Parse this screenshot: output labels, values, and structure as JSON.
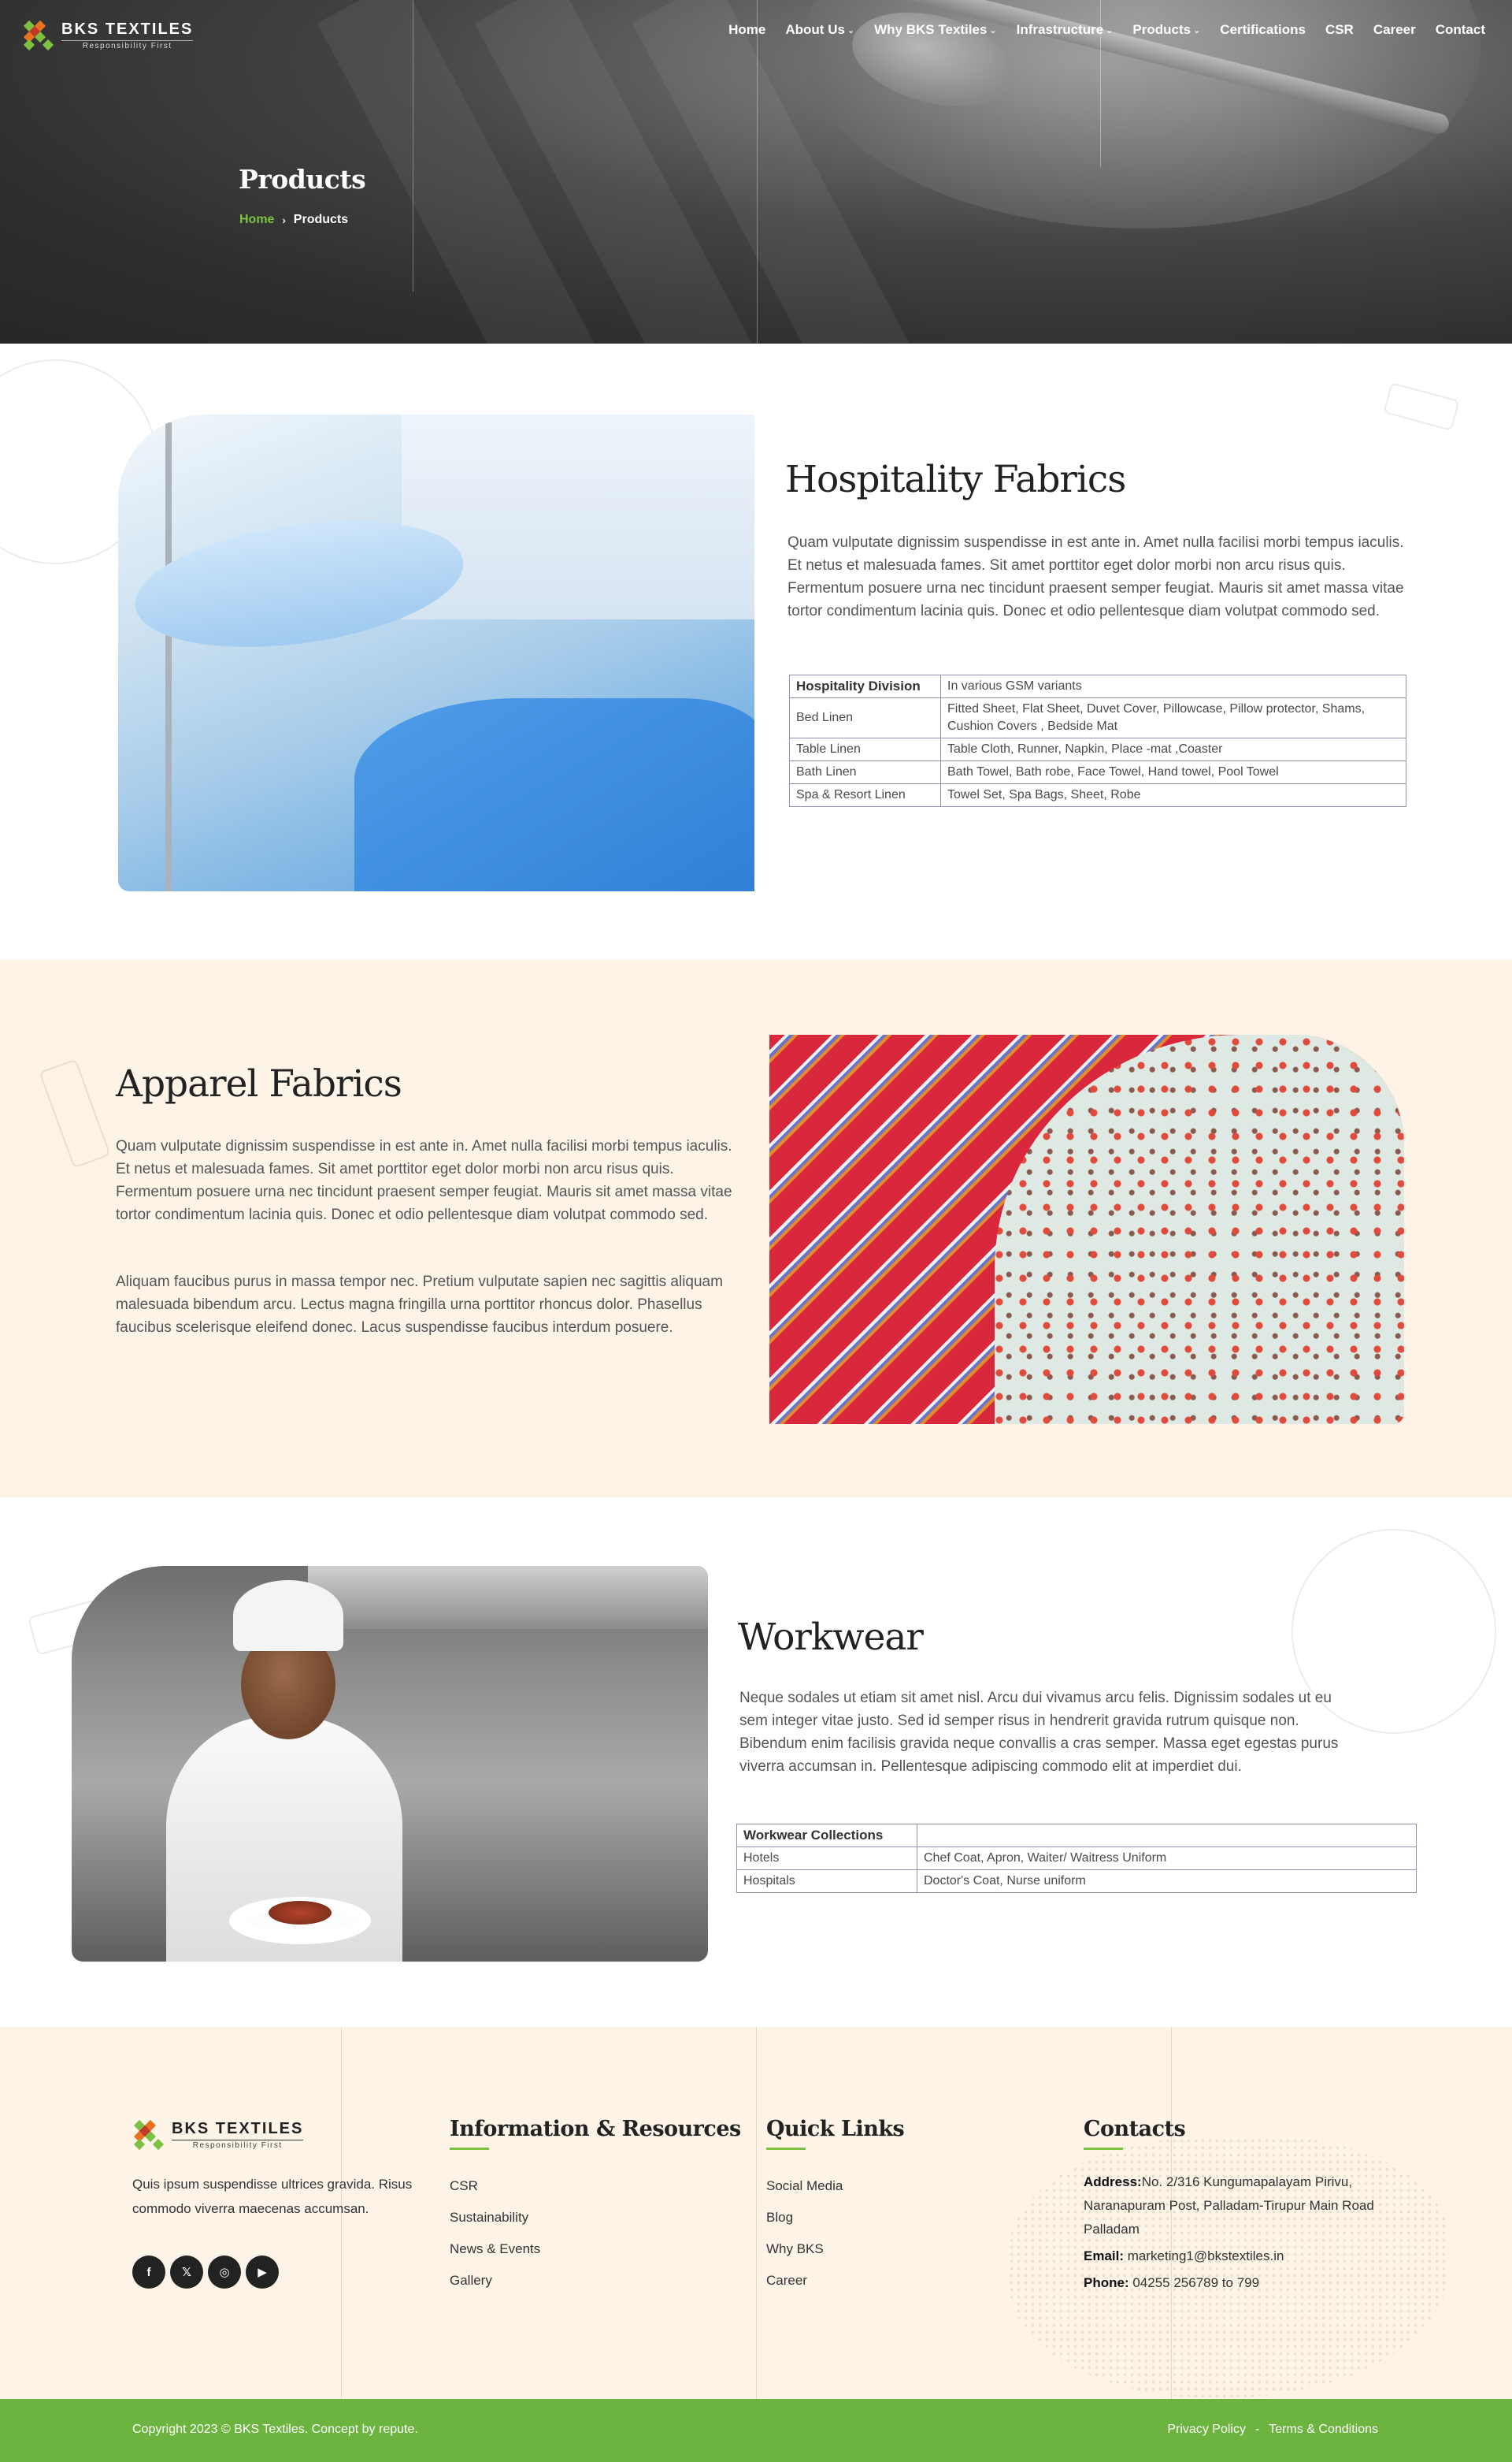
{
  "header": {
    "logo_name": "BKS TEXTILES",
    "logo_tagline": "Responsibility First",
    "nav": [
      {
        "label": "Home",
        "dropdown": false
      },
      {
        "label": "About Us",
        "dropdown": true
      },
      {
        "label": "Why BKS Textiles",
        "dropdown": true
      },
      {
        "label": "Infrastructure",
        "dropdown": true
      },
      {
        "label": "Products",
        "dropdown": true
      },
      {
        "label": "Certifications",
        "dropdown": false
      },
      {
        "label": "CSR",
        "dropdown": false
      },
      {
        "label": "Career",
        "dropdown": false
      },
      {
        "label": "Contact",
        "dropdown": false
      }
    ],
    "chevron": "⌄"
  },
  "hero": {
    "title": "Products",
    "breadcrumb_home": "Home",
    "breadcrumb_separator": "›",
    "breadcrumb_current": "Products"
  },
  "hospitality": {
    "title": "Hospitality Fabrics",
    "text": "Quam vulputate dignissim suspendisse in est ante in. Amet nulla facilisi morbi tempus iaculis. Et netus et malesuada fames. Sit amet porttitor eget dolor morbi non arcu risus quis. Fermentum posuere urna nec tincidunt praesent semper feugiat. Mauris sit amet massa vitae tortor condimentum lacinia quis. Donec et odio pellentesque diam volutpat commodo sed.",
    "table_header": [
      "Hospitality Division",
      "In various GSM variants"
    ],
    "table_rows": [
      [
        "Bed Linen",
        "Fitted Sheet, Flat Sheet, Duvet Cover, Pillowcase, Pillow protector, Shams, Cushion Covers , Bedside Mat"
      ],
      [
        "Table Linen",
        "Table Cloth, Runner, Napkin,  Place -mat ,Coaster"
      ],
      [
        "Bath Linen",
        "Bath Towel, Bath robe, Face Towel, Hand towel, Pool Towel"
      ],
      [
        "Spa & Resort Linen",
        "Towel Set, Spa Bags, Sheet, Robe"
      ]
    ]
  },
  "apparel": {
    "title": "Apparel Fabrics",
    "text_1": "Quam vulputate dignissim suspendisse in est ante in. Amet nulla facilisi morbi tempus iaculis. Et netus et malesuada fames. Sit amet porttitor eget dolor morbi non arcu risus quis. Fermentum posuere urna nec tincidunt praesent semper feugiat. Mauris sit amet massa vitae tortor condimentum lacinia quis. Donec et odio pellentesque diam volutpat commodo sed.",
    "text_2": "Aliquam faucibus purus in massa tempor nec. Pretium vulputate sapien nec sagittis aliquam malesuada bibendum arcu. Lectus magna fringilla urna porttitor rhoncus dolor. Phasellus faucibus scelerisque eleifend donec. Lacus suspendisse faucibus interdum posuere."
  },
  "workwear": {
    "title": "Workwear",
    "text": "Neque sodales ut etiam sit amet nisl. Arcu dui vivamus arcu felis. Dignissim sodales ut eu sem integer vitae justo. Sed id semper risus in hendrerit gravida rutrum quisque non. Bibendum enim facilisis gravida neque convallis a cras semper. Massa eget egestas purus viverra accumsan in. Pellentesque adipiscing commodo elit at imperdiet dui.",
    "table_header": [
      "Workwear Collections",
      ""
    ],
    "table_rows": [
      [
        "Hotels",
        "Chef Coat, Apron, Waiter/ Waitress Uniform"
      ],
      [
        "Hospitals",
        "Doctor's Coat, Nurse uniform"
      ]
    ]
  },
  "footer": {
    "logo_name": "BKS TEXTILES",
    "logo_tagline": "Responsibility First",
    "description": "Quis ipsum suspendisse ultrices gravida. Risus commodo viverra maecenas accumsan.",
    "social": [
      {
        "icon": "facebook-icon",
        "glyph": "f"
      },
      {
        "icon": "x-icon",
        "glyph": "𝕏"
      },
      {
        "icon": "instagram-icon",
        "glyph": "◎"
      },
      {
        "icon": "youtube-icon",
        "glyph": "▶"
      }
    ],
    "info_title": "Information & Resources",
    "info_links": [
      "CSR",
      "Sustainability",
      "News & Events",
      "Gallery"
    ],
    "quick_title": "Quick Links",
    "quick_links": [
      "Social Media",
      "Blog",
      "Why BKS",
      "Career"
    ],
    "contacts_title": "Contacts",
    "address_label": "Address:",
    "address": "No. 2/316 Kungumapalayam Pirivu, Naranapuram Post, Palladam-Tirupur Main Road Palladam",
    "email_label": "Email:",
    "email": "marketing1@bkstextiles.in",
    "phone_label": "Phone:",
    "phone": "04255 256789 to 799"
  },
  "copyright": {
    "text": "Copyright 2023 © BKS Textiles. Concept by repute.",
    "privacy": "Privacy Policy",
    "separator": "-",
    "terms": "Terms & Conditions"
  },
  "colors": {
    "accent_green": "#7dc142",
    "footer_bar": "#6cb33f",
    "cream": "#fdf3e7"
  }
}
